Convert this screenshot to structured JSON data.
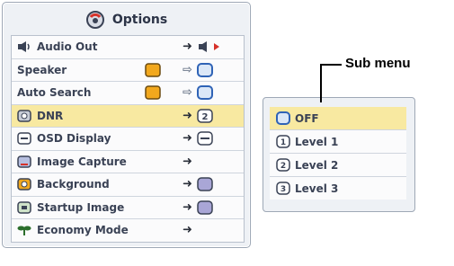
{
  "options": {
    "title": "Options",
    "items": [
      {
        "label": "Audio Out"
      },
      {
        "label": "Speaker"
      },
      {
        "label": "Auto Search"
      },
      {
        "label": "DNR",
        "value_glyph": "2"
      },
      {
        "label": "OSD Display"
      },
      {
        "label": "Image Capture"
      },
      {
        "label": "Background"
      },
      {
        "label": "Startup Image"
      },
      {
        "label": "Economy Mode"
      }
    ],
    "selected_index": 3
  },
  "submenu": {
    "items": [
      {
        "label": "OFF",
        "glyph": ""
      },
      {
        "label": "Level 1",
        "glyph": "1"
      },
      {
        "label": "Level 2",
        "glyph": "2"
      },
      {
        "label": "Level 3",
        "glyph": "3"
      }
    ],
    "selected_index": 0
  },
  "callout": {
    "label": "Sub menu"
  },
  "colors": {
    "highlight": "#f8e9a1",
    "accent_orange": "#f2a81d",
    "accent_blue": "#2f63b6",
    "red": "#d6322a"
  },
  "icons": {
    "title": "options-icon",
    "audio_out": "speaker-icon",
    "dnr": "dnr-icon",
    "osd_display": "osd-display-icon",
    "image_capture": "image-capture-icon",
    "background": "background-icon",
    "startup_image": "startup-image-icon",
    "economy_mode": "economy-mode-icon"
  }
}
